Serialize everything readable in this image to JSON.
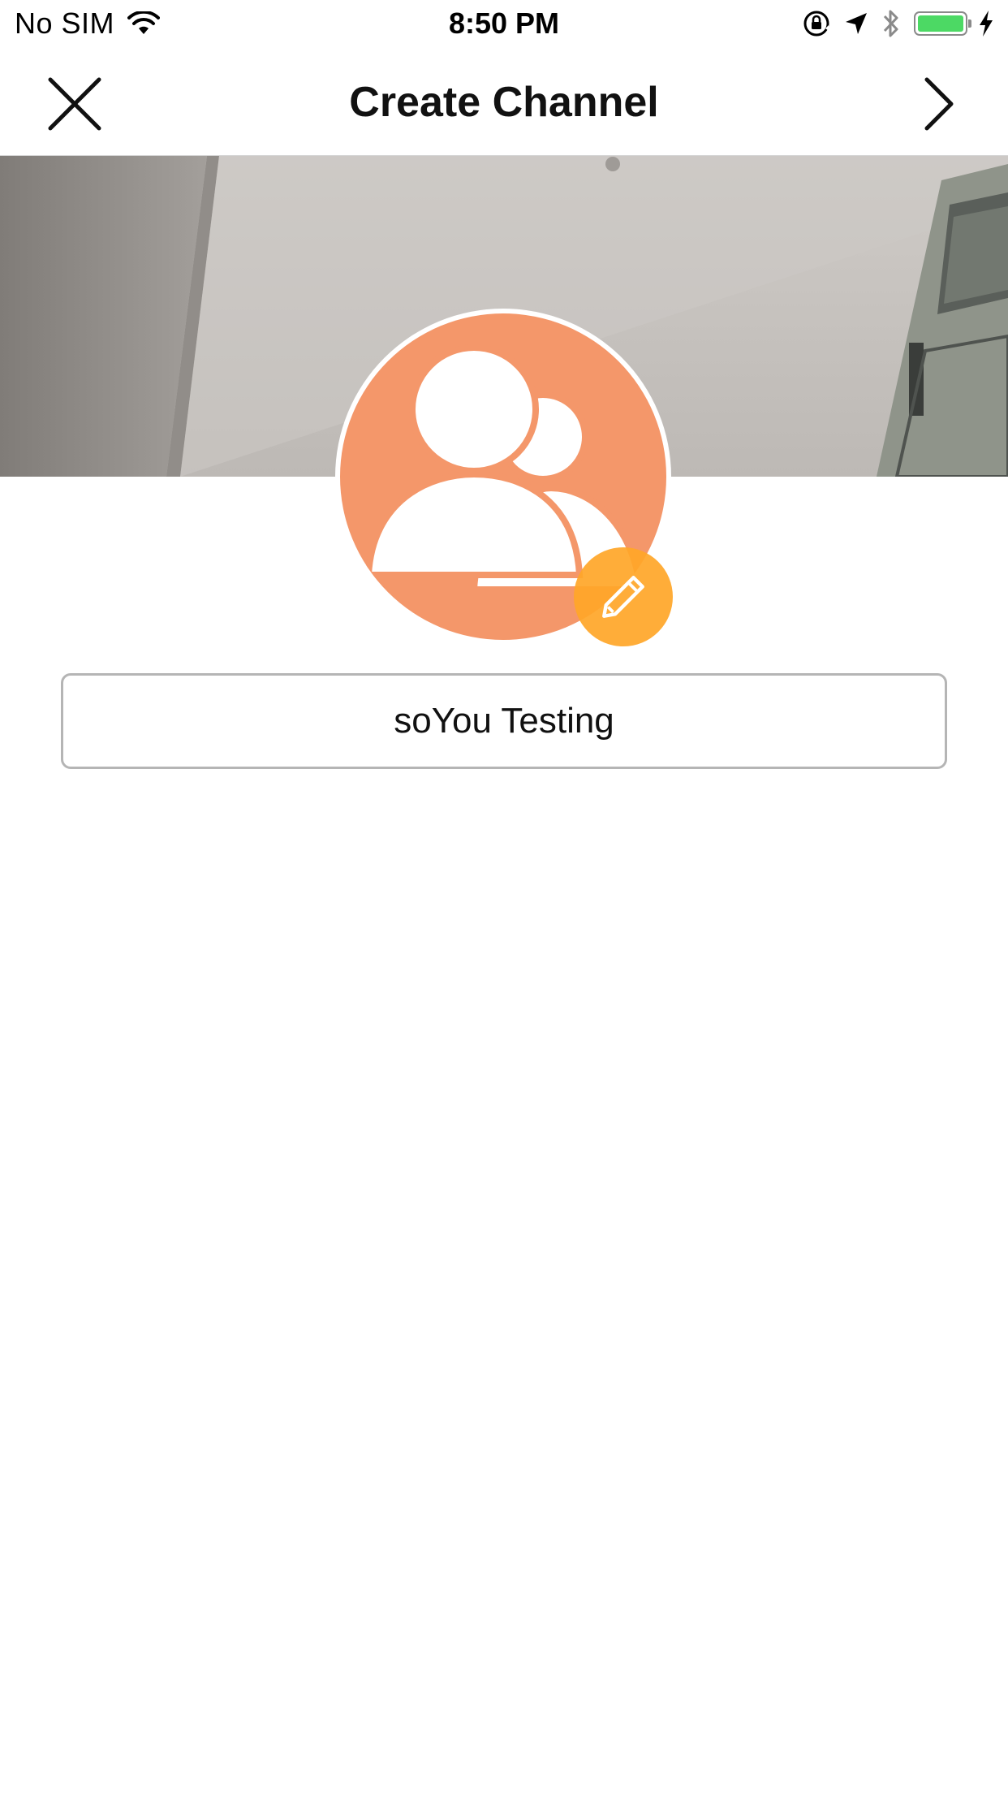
{
  "status_bar": {
    "carrier": "No SIM",
    "time": "8:50 PM",
    "battery_color": "#4cd964"
  },
  "nav": {
    "title": "Create Channel",
    "close_icon": "close-icon",
    "next_icon": "chevron-right-icon"
  },
  "cover": {
    "edit_icon": "pencil-icon",
    "edit_bg": "#e8921f"
  },
  "avatar": {
    "icon": "group-users-icon",
    "bg": "#f4976a",
    "edit_icon": "pencil-icon",
    "edit_bg": "#ffa628"
  },
  "channel_name": {
    "value": "soYou Testing"
  }
}
